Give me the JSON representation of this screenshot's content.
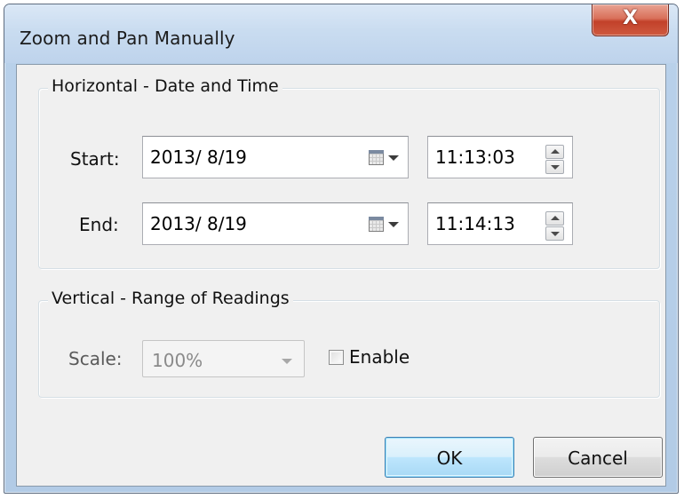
{
  "window": {
    "title": "Zoom and Pan Manually",
    "close_glyph": "X"
  },
  "horizontal": {
    "title": "Horizontal - Date and Time",
    "start": {
      "label": "Start:",
      "date": "2013/ 8/19",
      "time": "11:13:03"
    },
    "end": {
      "label": "End:",
      "date": "2013/ 8/19",
      "time": "11:14:13"
    }
  },
  "vertical": {
    "title": "Vertical - Range of Readings",
    "scale_label": "Scale:",
    "scale_value": "100%",
    "scale_enabled": false,
    "enable_label": "Enable",
    "enable_checked": false
  },
  "buttons": {
    "ok": "OK",
    "cancel": "Cancel"
  },
  "icons": {
    "close": "close-icon",
    "calendar": "calendar-icon",
    "dropdown": "chevron-down-icon",
    "spin_up": "spin-up-icon",
    "spin_down": "spin-down-icon"
  }
}
